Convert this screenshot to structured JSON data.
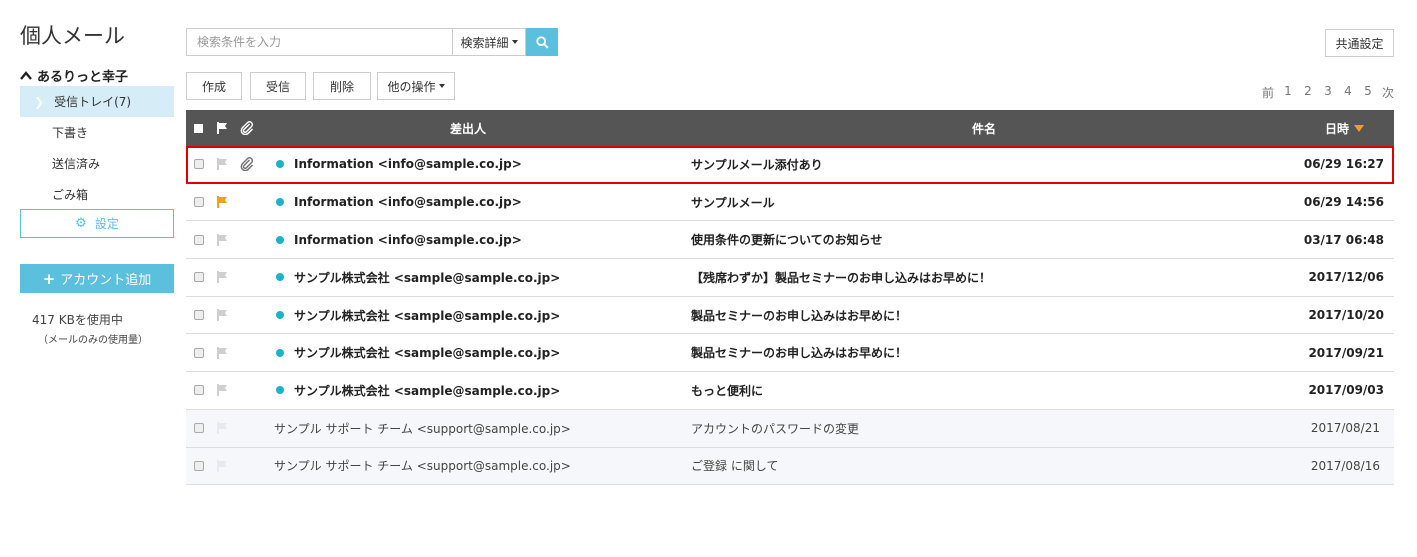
{
  "app_title": "個人メール",
  "account": {
    "name": "あるりっと幸子"
  },
  "folders": [
    {
      "label": "受信トレイ(7)",
      "active": true
    },
    {
      "label": "下書き",
      "active": false
    },
    {
      "label": "送信済み",
      "active": false
    },
    {
      "label": "ごみ箱",
      "active": false
    }
  ],
  "sidebar": {
    "settings_label": "設定",
    "add_account_label": "アカウント追加",
    "usage": "417 KBを使用中",
    "usage_note": "（メールのみの使用量）"
  },
  "search": {
    "placeholder": "検索条件を入力",
    "detail_label": "検索詳細"
  },
  "common_settings_label": "共通設定",
  "toolbar": {
    "compose": "作成",
    "receive": "受信",
    "delete": "削除",
    "other": "他の操作"
  },
  "pager": {
    "prev": "前",
    "pages": [
      "1",
      "2",
      "3",
      "4",
      "5"
    ],
    "next": "次"
  },
  "table": {
    "headers": {
      "sender": "差出人",
      "subject": "件名",
      "date": "日時"
    },
    "rows": [
      {
        "sender": "Information <info@sample.co.jp>",
        "subject": "サンプルメール添付あり",
        "date": "06/29 16:27",
        "unread": true,
        "flagged": false,
        "attachment": true,
        "selected": true
      },
      {
        "sender": "Information <info@sample.co.jp>",
        "subject": "サンプルメール",
        "date": "06/29 14:56",
        "unread": true,
        "flagged": true,
        "attachment": false,
        "selected": false
      },
      {
        "sender": "Information <info@sample.co.jp>",
        "subject": "使用条件の更新についてのお知らせ",
        "date": "03/17 06:48",
        "unread": true,
        "flagged": false,
        "attachment": false,
        "selected": false
      },
      {
        "sender": "サンプル株式会社 <sample@sample.co.jp>",
        "subject": "【残席わずか】製品セミナーのお申し込みはお早めに！",
        "date": "2017/12/06",
        "unread": true,
        "flagged": false,
        "attachment": false,
        "selected": false
      },
      {
        "sender": "サンプル株式会社 <sample@sample.co.jp>",
        "subject": "製品セミナーのお申し込みはお早めに！",
        "date": "2017/10/20",
        "unread": true,
        "flagged": false,
        "attachment": false,
        "selected": false
      },
      {
        "sender": "サンプル株式会社 <sample@sample.co.jp>",
        "subject": "製品セミナーのお申し込みはお早めに！",
        "date": "2017/09/21",
        "unread": true,
        "flagged": false,
        "attachment": false,
        "selected": false
      },
      {
        "sender": "サンプル株式会社 <sample@sample.co.jp>",
        "subject": "もっと便利に",
        "date": "2017/09/03",
        "unread": true,
        "flagged": false,
        "attachment": false,
        "selected": false
      },
      {
        "sender": "サンプル サポート チーム <support@sample.co.jp>",
        "subject": "アカウントのパスワードの変更",
        "date": "2017/08/21",
        "unread": false,
        "flagged": false,
        "attachment": false,
        "selected": false
      },
      {
        "sender": "サンプル サポート チーム <support@sample.co.jp>",
        "subject": "ご登録 に関して",
        "date": "2017/08/16",
        "unread": false,
        "flagged": false,
        "attachment": false,
        "selected": false
      }
    ]
  },
  "colors": {
    "accent": "#5bc0de",
    "header_bg": "#555555",
    "unread_dot": "#1ab3c9",
    "flag_active": "#f0a020",
    "selection_border": "#e00000"
  },
  "icons": {
    "search": "search-icon",
    "gear": "gear-icon",
    "flag": "flag-icon",
    "clip": "paperclip-icon",
    "sort": "sort-desc-icon"
  }
}
